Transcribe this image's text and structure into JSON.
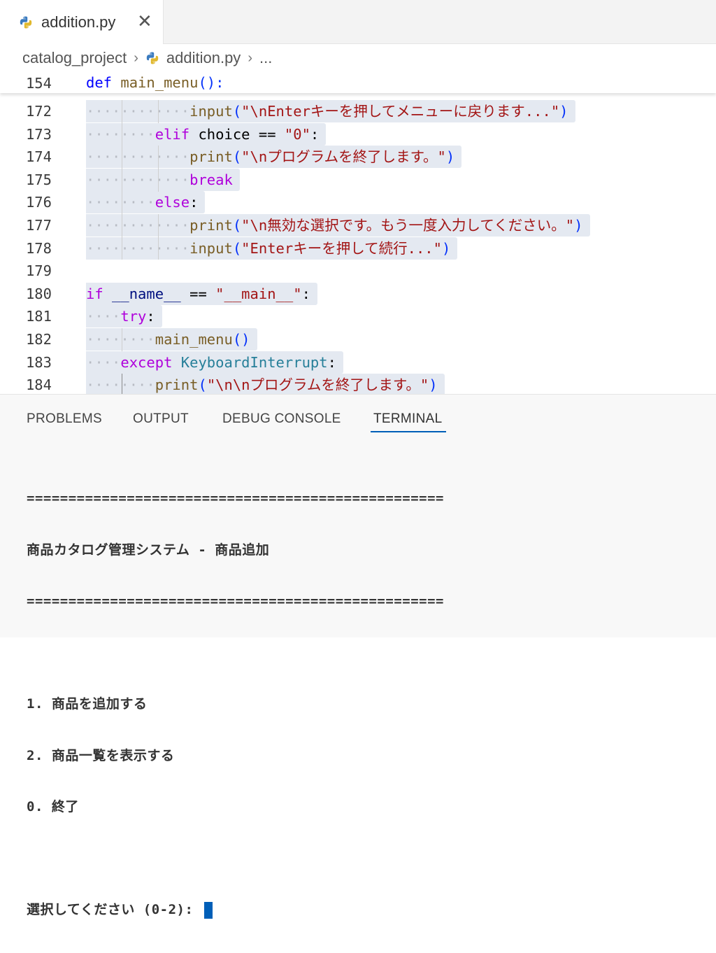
{
  "tab": {
    "label": "addition.py",
    "close": "✕"
  },
  "breadcrumb": {
    "folder": "catalog_project",
    "file": "addition.py",
    "more": "..."
  },
  "sticky": {
    "line": "154",
    "code_def": "def",
    "code_name": "main_menu",
    "code_rest": "():"
  },
  "lines": {
    "n172": "172",
    "n173": "173",
    "n174": "174",
    "n175": "175",
    "n176": "176",
    "n177": "177",
    "n178": "178",
    "n179": "179",
    "n180": "180",
    "n181": "181",
    "n182": "182",
    "n183": "183",
    "n184": "184"
  },
  "code": {
    "l172_fn": "input",
    "l172_str": "\"\\nEnterキーを押してメニューに戻ります...\"",
    "l173_kw": "elif",
    "l173_id": " choice == ",
    "l173_str": "\"0\"",
    "l173_end": ":",
    "l174_fn": "print",
    "l174_str": "\"\\nプログラムを終了します。\"",
    "l175_kw": "break",
    "l176_kw": "else",
    "l176_end": ":",
    "l177_fn": "print",
    "l177_str": "\"\\n無効な選択です。もう一度入力してください。\"",
    "l178_fn": "input",
    "l178_str": "\"Enterキーを押して続行...\"",
    "l180_kw": "if",
    "l180_id": "__name__",
    "l180_op": " == ",
    "l180_str": "\"__main__\"",
    "l180_end": ":",
    "l181_kw": "try",
    "l181_end": ":",
    "l182_fn": "main_menu",
    "l182_end": "()",
    "l183_kw": "except",
    "l183_tp": "KeyboardInterrupt",
    "l183_end": ":",
    "l184_fn": "print",
    "l184_str": "\"\\n\\nプログラムを終了します。\""
  },
  "panel_tabs": [
    "PROBLEMS",
    "OUTPUT",
    "DEBUG CONSOLE",
    "TERMINAL"
  ],
  "terminal": {
    "sep1": "==================================================",
    "title": "商品カタログ管理システム - 商品追加",
    "sep2": "==================================================",
    "blank1": "",
    "opt1": "1. 商品を追加する",
    "opt2": "2. 商品一覧を表示する",
    "opt0": "0. 終了",
    "blank2": "",
    "prompt": "選択してください (0-2): "
  },
  "colors": {
    "accent": "#005fb8",
    "keyword": "#af00db",
    "string": "#a31515",
    "function": "#795e26",
    "selection": "#e4e9f1"
  }
}
